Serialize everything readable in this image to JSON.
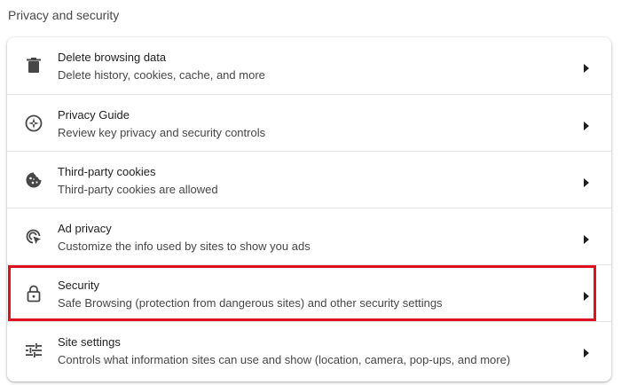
{
  "section": {
    "title": "Privacy and security"
  },
  "items": [
    {
      "icon": "trash-icon",
      "title": "Delete browsing data",
      "subtitle": "Delete history, cookies, cache, and more"
    },
    {
      "icon": "compass-icon",
      "title": "Privacy Guide",
      "subtitle": "Review key privacy and security controls"
    },
    {
      "icon": "cookie-icon",
      "title": "Third-party cookies",
      "subtitle": "Third-party cookies are allowed"
    },
    {
      "icon": "ad-privacy-icon",
      "title": "Ad privacy",
      "subtitle": "Customize the info used by sites to show you ads"
    },
    {
      "icon": "lock-icon",
      "title": "Security",
      "subtitle": "Safe Browsing (protection from dangerous sites) and other security settings",
      "highlighted": true
    },
    {
      "icon": "sliders-icon",
      "title": "Site settings",
      "subtitle": "Controls what information sites can use and show (location, camera, pop-ups, and more)"
    }
  ],
  "colors": {
    "highlight_border": "#e0101e",
    "icon": "#474747",
    "divider": "#e3e3e3"
  }
}
